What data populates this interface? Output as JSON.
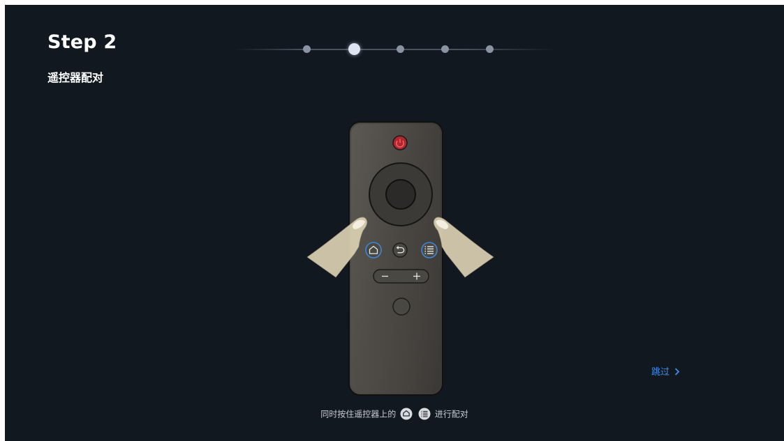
{
  "step": {
    "title": "Step 2",
    "subtitle": "遥控器配对"
  },
  "progress": {
    "total_steps": 5,
    "current_step": 2
  },
  "hint": {
    "prefix": "同时按住遥控器上的",
    "icons": [
      "home-icon",
      "menu-icon"
    ],
    "suffix": "进行配对"
  },
  "skip": {
    "label": "跳过",
    "icon": "chevron-right-icon"
  },
  "colors": {
    "background": "#111820",
    "link": "#3f8fe8",
    "power_button": "#b4262e",
    "remote_body": "#494641"
  },
  "illustration": {
    "icons": [
      "power-icon",
      "home-icon",
      "back-icon",
      "menu-icon",
      "minus-icon",
      "plus-icon"
    ]
  }
}
